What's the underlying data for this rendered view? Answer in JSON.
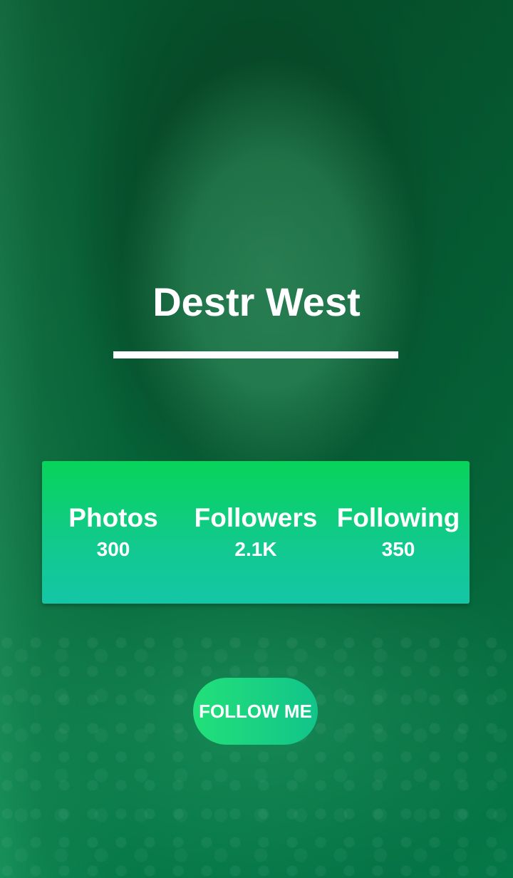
{
  "profile": {
    "name": "Destr West"
  },
  "stats": [
    {
      "label": "Photos",
      "value": "300"
    },
    {
      "label": "Followers",
      "value": "2.1K"
    },
    {
      "label": "Following",
      "value": "350"
    }
  ],
  "actions": {
    "follow_label": "FOLLOW ME"
  },
  "colors": {
    "overlay": "#0a6b3e",
    "card_top": "#07d45a",
    "card_bottom": "#14c6a6",
    "button_start": "#22e07a",
    "button_end": "#12c48a",
    "text": "#ffffff"
  }
}
